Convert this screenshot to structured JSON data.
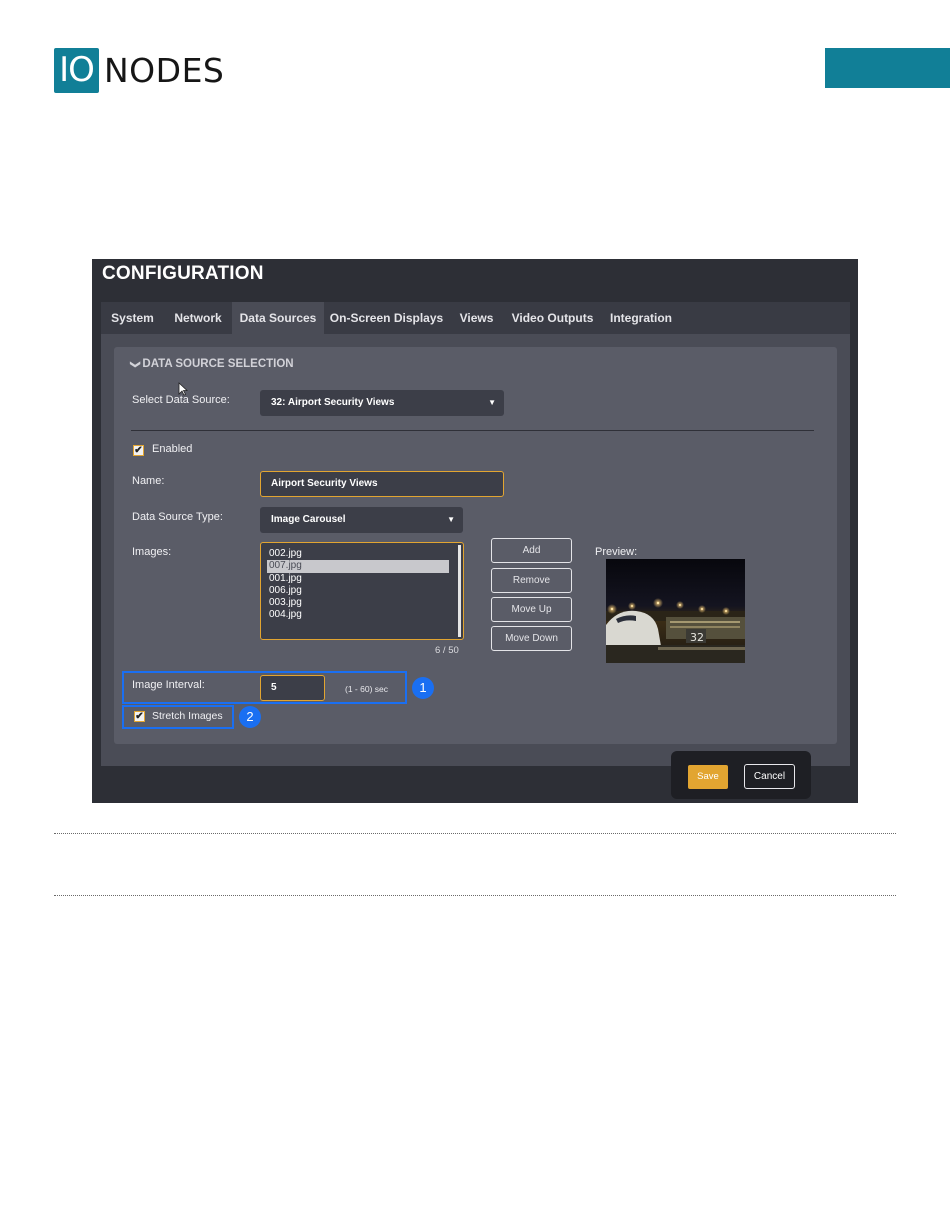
{
  "header": {
    "logo_io": "IO",
    "logo_nodes": "NODES",
    "brand_color": "#117f97"
  },
  "config": {
    "title": "CONFIGURATION",
    "tabs": [
      "System",
      "Network",
      "Data Sources",
      "On-Screen Displays",
      "Views",
      "Video Outputs",
      "Integration"
    ],
    "active_tab": "Data Sources"
  },
  "section": {
    "title": "DATA SOURCE SELECTION",
    "icon": "chevron-down-icon"
  },
  "form": {
    "select_source_label": "Select Data Source:",
    "select_source_value": "32: Airport Security Views",
    "enabled_label": "Enabled",
    "enabled_checked": true,
    "name_label": "Name:",
    "name_value": "Airport Security Views",
    "type_label": "Data Source Type:",
    "type_value": "Image Carousel",
    "images_label": "Images:",
    "images": [
      "002.jpg",
      "007.jpg",
      "001.jpg",
      "006.jpg",
      "003.jpg",
      "004.jpg"
    ],
    "selected_image": "007.jpg",
    "image_count": "6 / 50",
    "preview_label": "Preview:",
    "interval_label": "Image Interval:",
    "interval_value": "5",
    "interval_hint": "(1 - 60) sec",
    "stretch_label": "Stretch Images",
    "stretch_checked": true
  },
  "image_buttons": {
    "add": "Add",
    "remove": "Remove",
    "move_up": "Move Up",
    "move_down": "Move Down"
  },
  "callouts": {
    "one": "1",
    "two": "2",
    "color": "#1a6ff2"
  },
  "footer": {
    "save": "Save",
    "cancel": "Cancel",
    "accent": "#e2a531"
  }
}
